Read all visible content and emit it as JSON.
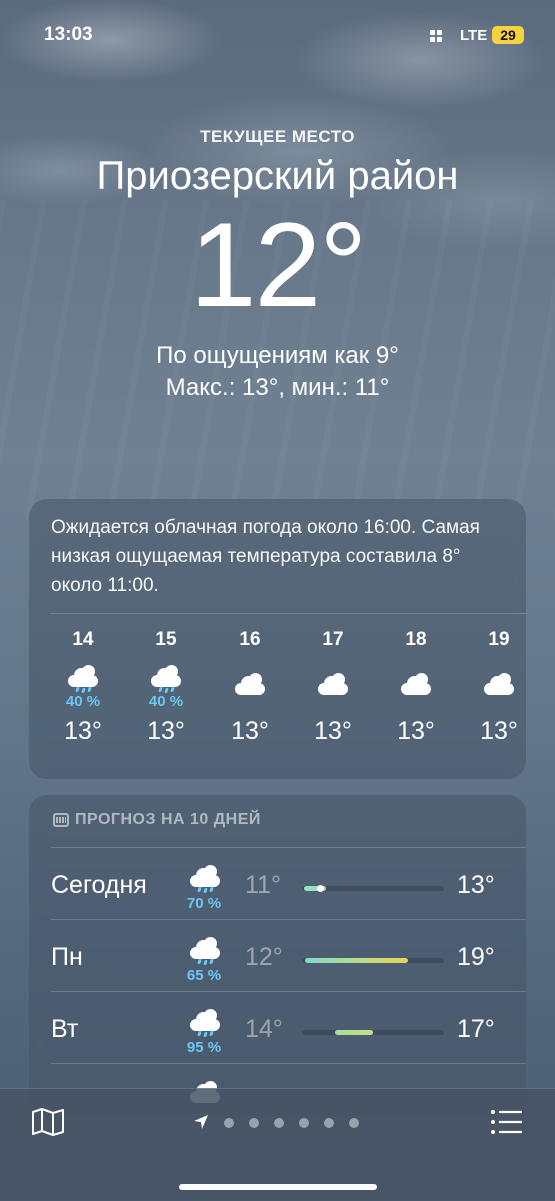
{
  "status": {
    "time": "13:03",
    "network": "LTE",
    "battery": "29"
  },
  "location": {
    "label": "ТЕКУЩЕЕ МЕСТО",
    "name": "Приозерский район"
  },
  "current": {
    "temp": "12°",
    "feels_like": "По ощущениям как 9°",
    "hi_lo": "Макс.: 13°, мин.: 11°"
  },
  "hourly": {
    "summary": "Ожидается облачная погода около 16:00. Самая низкая ощущаемая температура составила 8° около 11:00.",
    "hours": [
      {
        "hour": "14",
        "icon": "cloud-rain-icon",
        "precip": "40 %",
        "temp": "13°"
      },
      {
        "hour": "15",
        "icon": "cloud-rain-icon",
        "precip": "40 %",
        "temp": "13°"
      },
      {
        "hour": "16",
        "icon": "cloud-icon",
        "precip": "",
        "temp": "13°"
      },
      {
        "hour": "17",
        "icon": "cloud-icon",
        "precip": "",
        "temp": "13°"
      },
      {
        "hour": "18",
        "icon": "cloud-icon",
        "precip": "",
        "temp": "13°"
      },
      {
        "hour": "19",
        "icon": "cloud-icon",
        "precip": "",
        "temp": "13°"
      }
    ]
  },
  "daily": {
    "header": "ПРОГНОЗ НА 10 ДНЕЙ",
    "days": [
      {
        "name": "Сегодня",
        "icon": "cloud-rain-icon",
        "precip": "70 %",
        "low": "11°",
        "high": "13°"
      },
      {
        "name": "Пн",
        "icon": "cloud-rain-icon",
        "precip": "65 %",
        "low": "12°",
        "high": "19°"
      },
      {
        "name": "Вт",
        "icon": "cloud-rain-icon",
        "precip": "95 %",
        "low": "14°",
        "high": "17°"
      }
    ]
  },
  "toolbar": {
    "map": "map-icon",
    "list": "list-icon",
    "pages": 6
  },
  "colors": {
    "precip": "#6cc7f5",
    "battery": "#f5d340"
  }
}
